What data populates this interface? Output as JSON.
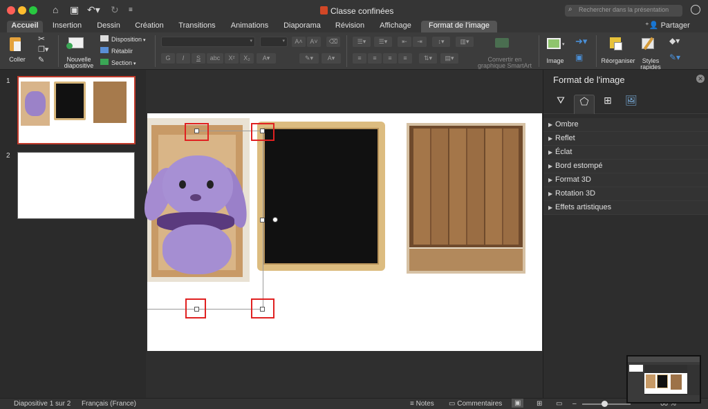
{
  "window": {
    "title": "Classe confinées"
  },
  "search": {
    "placeholder": "Rechercher dans la présentation"
  },
  "tabs": [
    "Accueil",
    "Insertion",
    "Dessin",
    "Création",
    "Transitions",
    "Animations",
    "Diaporama",
    "Révision",
    "Affichage",
    "Format de l’image"
  ],
  "share_label": "Partager",
  "ribbon": {
    "coller": "Coller",
    "nouvelle_diapositive": [
      "Nouvelle",
      "diapositive"
    ],
    "disposition": "Disposition",
    "retablir": "Rétablir",
    "section": "Section",
    "convertir": [
      "Convertir en",
      "graphique SmartArt"
    ],
    "image": "Image",
    "reorganiser": "Réorganiser",
    "styles_rapides": [
      "Styles",
      "rapides"
    ],
    "font_buttons": [
      "G",
      "I",
      "S",
      "abc",
      "X²",
      "X₂"
    ]
  },
  "slides": [
    {
      "num": "1"
    },
    {
      "num": "2"
    }
  ],
  "format_panel": {
    "title": "Format de l'image",
    "sections": [
      "Ombre",
      "Reflet",
      "Éclat",
      "Bord estompé",
      "Format 3D",
      "Rotation 3D",
      "Effets artistiques"
    ]
  },
  "status": {
    "slide_info": "Diapositive 1 sur 2",
    "language": "Français (France)",
    "notes": "Notes",
    "comments": "Commentaires",
    "zoom": "60 %"
  }
}
